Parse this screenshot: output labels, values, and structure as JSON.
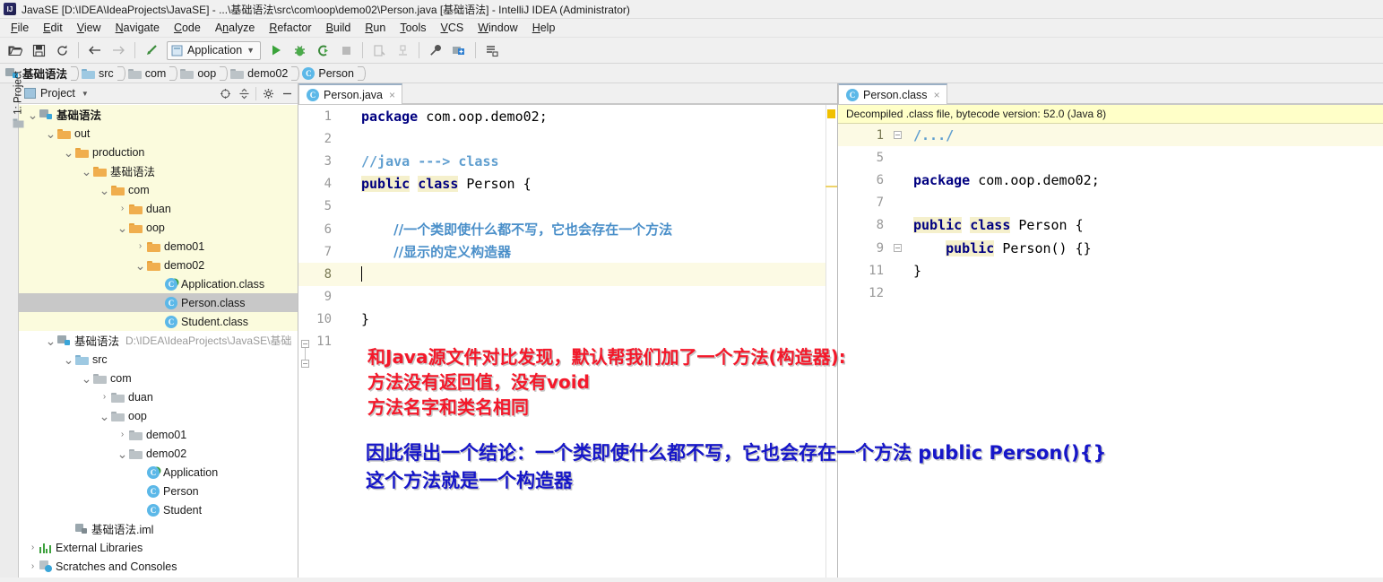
{
  "window": {
    "title": "JavaSE [D:\\IDEA\\IdeaProjects\\JavaSE] - ...\\基础语法\\src\\com\\oop\\demo02\\Person.java [基础语法] - IntelliJ IDEA (Administrator)",
    "app_logo": "IJ"
  },
  "menubar": {
    "items": [
      {
        "label": "File"
      },
      {
        "label": "Edit"
      },
      {
        "label": "View"
      },
      {
        "label": "Navigate"
      },
      {
        "label": "Code"
      },
      {
        "label": "Analyze"
      },
      {
        "label": "Refactor"
      },
      {
        "label": "Build"
      },
      {
        "label": "Run"
      },
      {
        "label": "Tools"
      },
      {
        "label": "VCS"
      },
      {
        "label": "Window"
      },
      {
        "label": "Help"
      }
    ]
  },
  "toolbar": {
    "run_config": "Application",
    "buttons": [
      {
        "name": "open-icon"
      },
      {
        "name": "save-all-icon"
      },
      {
        "name": "sync-icon"
      },
      {
        "name": "back-icon"
      },
      {
        "name": "forward-icon"
      },
      {
        "name": "undo-icon"
      },
      {
        "name": "run-icon"
      },
      {
        "name": "debug-icon"
      },
      {
        "name": "run-coverage-icon"
      },
      {
        "name": "stop-icon"
      },
      {
        "name": "build-project-icon"
      },
      {
        "name": "build-module-icon"
      },
      {
        "name": "settings-wrench-icon"
      },
      {
        "name": "project-structure-icon"
      },
      {
        "name": "sdk-manager-icon"
      }
    ]
  },
  "breadcrumb": {
    "items": [
      {
        "label": "基础语法",
        "icon": "module-icon",
        "active": true
      },
      {
        "label": "src",
        "icon": "source-folder-icon",
        "active": false
      },
      {
        "label": "com",
        "icon": "package-icon",
        "active": false
      },
      {
        "label": "oop",
        "icon": "package-icon",
        "active": false
      },
      {
        "label": "demo02",
        "icon": "package-icon",
        "active": false
      },
      {
        "label": "Person",
        "icon": "class-icon",
        "active": false
      }
    ]
  },
  "left_strip": {
    "project_tab": "1: Project"
  },
  "project_panel": {
    "title": "Project",
    "tools": [
      "collapse-target-icon",
      "collapse-all-icon",
      "settings-gear-icon",
      "hide-panel-icon"
    ],
    "tree": [
      {
        "indent": 0,
        "arrow": "down",
        "icon": "module-icon",
        "label": "基础语法",
        "bold": true,
        "tint": true
      },
      {
        "indent": 1,
        "arrow": "down",
        "icon": "folder-icon",
        "label": "out",
        "bold": false,
        "tint": true
      },
      {
        "indent": 2,
        "arrow": "down",
        "icon": "folder-icon",
        "label": "production",
        "bold": false,
        "tint": true
      },
      {
        "indent": 3,
        "arrow": "down",
        "icon": "folder-icon",
        "label": "基础语法",
        "bold": false,
        "tint": true
      },
      {
        "indent": 4,
        "arrow": "down",
        "icon": "folder-icon",
        "label": "com",
        "bold": false,
        "tint": true
      },
      {
        "indent": 5,
        "arrow": "right",
        "icon": "folder-icon",
        "label": "duan",
        "bold": false,
        "tint": true
      },
      {
        "indent": 5,
        "arrow": "down",
        "icon": "folder-icon",
        "label": "oop",
        "bold": false,
        "tint": true
      },
      {
        "indent": 6,
        "arrow": "right",
        "icon": "folder-icon",
        "label": "demo01",
        "bold": false,
        "tint": true
      },
      {
        "indent": 6,
        "arrow": "down",
        "icon": "folder-icon",
        "label": "demo02",
        "bold": false,
        "tint": true
      },
      {
        "indent": 7,
        "arrow": "none",
        "icon": "class-runnable-icon",
        "label": "Application.class",
        "bold": false,
        "tint": true
      },
      {
        "indent": 7,
        "arrow": "none",
        "icon": "class-icon",
        "label": "Person.class",
        "bold": false,
        "tint": false,
        "selected": true
      },
      {
        "indent": 7,
        "arrow": "none",
        "icon": "class-icon",
        "label": "Student.class",
        "bold": false,
        "tint": true
      },
      {
        "indent": 1,
        "arrow": "down",
        "icon": "module-icon",
        "label": "基础语法",
        "bold": false,
        "tint": false,
        "path": "D:\\IDEA\\IdeaProjects\\JavaSE\\基础"
      },
      {
        "indent": 2,
        "arrow": "down",
        "icon": "source-folder-icon",
        "label": "src",
        "bold": false,
        "tint": false
      },
      {
        "indent": 3,
        "arrow": "down",
        "icon": "package-icon",
        "label": "com",
        "bold": false,
        "tint": false
      },
      {
        "indent": 4,
        "arrow": "right",
        "icon": "package-icon",
        "label": "duan",
        "bold": false,
        "tint": false
      },
      {
        "indent": 4,
        "arrow": "down",
        "icon": "package-icon",
        "label": "oop",
        "bold": false,
        "tint": false
      },
      {
        "indent": 5,
        "arrow": "right",
        "icon": "package-icon",
        "label": "demo01",
        "bold": false,
        "tint": false
      },
      {
        "indent": 5,
        "arrow": "down",
        "icon": "package-icon",
        "label": "demo02",
        "bold": false,
        "tint": false
      },
      {
        "indent": 6,
        "arrow": "none",
        "icon": "class-runnable-icon",
        "label": "Application",
        "bold": false,
        "tint": false
      },
      {
        "indent": 6,
        "arrow": "none",
        "icon": "class-icon",
        "label": "Person",
        "bold": false,
        "tint": false
      },
      {
        "indent": 6,
        "arrow": "none",
        "icon": "class-icon",
        "label": "Student",
        "bold": false,
        "tint": false
      },
      {
        "indent": 2,
        "arrow": "none",
        "icon": "iml-icon",
        "label": "基础语法.iml",
        "bold": false,
        "tint": false
      },
      {
        "indent": 0,
        "arrow": "right",
        "icon": "libraries-icon",
        "label": "External Libraries",
        "bold": false,
        "tint": false
      },
      {
        "indent": 0,
        "arrow": "right",
        "icon": "scratches-icon",
        "label": "Scratches and Consoles",
        "bold": false,
        "tint": false
      }
    ]
  },
  "editor_left": {
    "tab": {
      "label": "Person.java",
      "icon": "class-icon",
      "close": "×"
    },
    "lines": [
      {
        "num": "1",
        "html_key": "l1"
      },
      {
        "num": "2",
        "html_key": "l2"
      },
      {
        "num": "3",
        "html_key": "l3"
      },
      {
        "num": "4",
        "html_key": "l4"
      },
      {
        "num": "5",
        "html_key": "l5"
      },
      {
        "num": "6",
        "html_key": "l6"
      },
      {
        "num": "7",
        "html_key": "l7"
      },
      {
        "num": "8",
        "html_key": "l8",
        "current": true
      },
      {
        "num": "9",
        "html_key": "l9"
      },
      {
        "num": "10",
        "html_key": "l10"
      },
      {
        "num": "11",
        "html_key": "l11"
      }
    ],
    "code": {
      "l1": "package com.oop.demo02;",
      "l2": "",
      "l3": "//java ---> class",
      "l4": "public class Person {",
      "l5": "",
      "l6": "    //一个类即使什么都不写，它也会存在一个方法",
      "l7": "    //显示的定义构造器",
      "l8": "",
      "l9": "",
      "l10": "}",
      "l11": ""
    }
  },
  "editor_right": {
    "tab": {
      "label": "Person.class",
      "icon": "class-icon",
      "close": "×"
    },
    "notice": "Decompiled .class file, bytecode version: 52.0 (Java 8)",
    "lines": [
      {
        "num": "1",
        "html_key": "r1",
        "current": true
      },
      {
        "num": "5",
        "html_key": "r5"
      },
      {
        "num": "6",
        "html_key": "r6"
      },
      {
        "num": "7",
        "html_key": "r7"
      },
      {
        "num": "8",
        "html_key": "r8"
      },
      {
        "num": "9",
        "html_key": "r9"
      },
      {
        "num": "11",
        "html_key": "r11"
      },
      {
        "num": "12",
        "html_key": "r12"
      }
    ],
    "code": {
      "r1": "/.../",
      "r5": "",
      "r6": "package com.oop.demo02;",
      "r7": "",
      "r8": "public class Person {",
      "r9": "    public Person() {}",
      "r11": "}",
      "r12": ""
    }
  },
  "annotations": {
    "red": [
      "和Java源文件对比发现，默认帮我们加了一个方法(构造器):",
      "方法没有返回值，没有void",
      "方法名字和类名相同"
    ],
    "blue": [
      "因此得出一个结论：一个类即使什么都不写，它也会存在一个方法 public Person(){}",
      "这个方法就是一个构造器"
    ]
  },
  "colors": {
    "keyword": "#000080",
    "comment": "#5f9ecf",
    "annotation_red": "#f4182a",
    "annotation_blue": "#1616c8",
    "notice_bg": "#ffffc8",
    "selection_bg": "#c8c8c8",
    "current_line_bg": "#fcfae4",
    "tree_tint_bg": "#fbfbdd"
  }
}
